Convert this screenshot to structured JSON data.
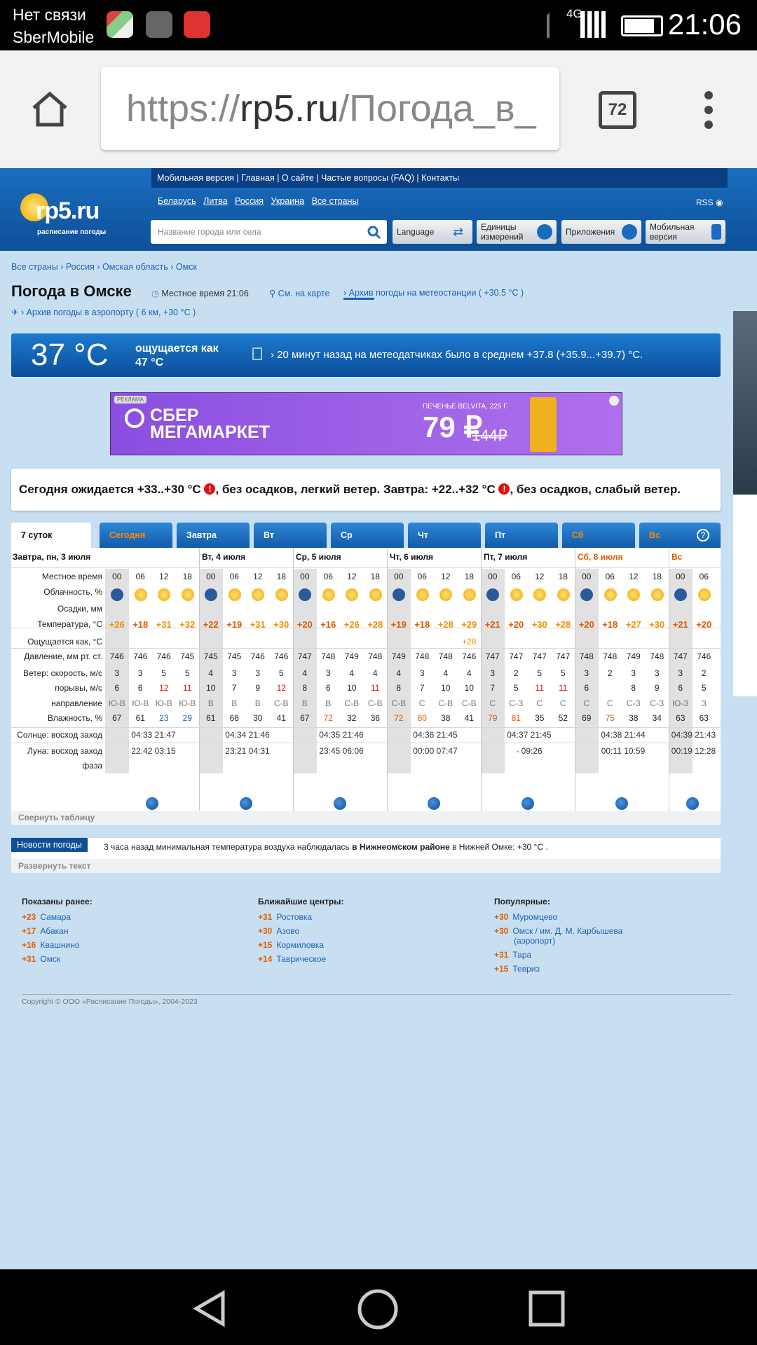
{
  "status_bar": {
    "carrier1": "Нет связи",
    "carrier2": "SberMobile",
    "time": "21:06",
    "network": "4G"
  },
  "browser": {
    "url_prefix": "https://",
    "url_host": "rp5.ru",
    "url_path": "/Погода_в_",
    "tabs_count": "72"
  },
  "site": {
    "topnav": "Мобильная версия  |  Главная  |  О сайте  |  Частые вопросы (FAQ)  |  Контакты",
    "countries": [
      "Беларусь",
      "Литва",
      "Россия",
      "Украина",
      "Все страны"
    ],
    "rss": "RSS",
    "logo_text": "rp5.ru",
    "logo_sub": "расписание погоды",
    "search_placeholder": "Название города или села",
    "btn_language": "Language",
    "btn_units": "Единицы измерений",
    "btn_apps": "Приложения",
    "btn_mobile": "Мобильная версия"
  },
  "breadcrumb": "Все страны › Россия › Омская область › Омск",
  "page_title": "Погода в Омске",
  "local_time": "Местное время  21:06",
  "map_link": "См. на карте",
  "archive_link": "› Архив погоды на метеостанции ( +30.5 °C )",
  "airport_link": "› Архив погоды в аэропорту ( 6 км, +30 °C )",
  "current": {
    "temp": "37 °C",
    "feels": "ощущается как 47 °C",
    "message": "›   20 минут назад на метеодатчиках было в среднем +37.8 (+35.9...+39.7) °C."
  },
  "ad": {
    "tag": "РЕКЛАМА",
    "brand": "СБЕР МЕГАМАРКЕТ",
    "product": "ПЕЧЕНЬЕ BELVITA, 225 Г",
    "price": "79 ₽",
    "old_price": "144₽"
  },
  "forecast_summary": {
    "p1": "Сегодня ожидается +33..+30 °C ",
    "p2": ", без осадков, легкий ветер. Завтра: +22..+32 °C ",
    "p3": ", без осадков, слабый ветер.",
    "warn": "!"
  },
  "day_tabs": [
    "7 суток",
    "Сегодня",
    "Завтра",
    "Вт",
    "Ср",
    "Чт",
    "Пт",
    "Сб",
    "Вс"
  ],
  "table": {
    "days": [
      "Завтра, пн, 3 июля",
      "Вт, 4 июля",
      "Ср, 5 июля",
      "Чт, 6 июля",
      "Пт, 7 июля",
      "Сб, 8 июля",
      "Вс"
    ],
    "row_labels": [
      "Местное время",
      "Облачность, %",
      "Осадки, мм",
      "Температура, °C",
      "Ощущается как, °C",
      "Давление, мм рт. ст.",
      "Ветер: скорость, м/с",
      "порывы, м/с",
      "направление",
      "Влажность, %",
      "Солнце: восход заход",
      "Луна: восход заход",
      "фаза"
    ],
    "hours": [
      "00",
      "06",
      "12",
      "18",
      "00",
      "06",
      "12",
      "18",
      "00",
      "06",
      "12",
      "18",
      "00",
      "06",
      "12",
      "18",
      "00",
      "06",
      "12",
      "18",
      "00",
      "06",
      "12",
      "18",
      "00",
      "06"
    ],
    "temps": [
      "+26",
      "+18",
      "+31",
      "+32",
      "+22",
      "+19",
      "+31",
      "+30",
      "+20",
      "+16",
      "+26",
      "+28",
      "+19",
      "+18",
      "+28",
      "+29",
      "+21",
      "+20",
      "+30",
      "+28",
      "+20",
      "+18",
      "+27",
      "+30",
      "+21",
      "+20"
    ],
    "feels": [
      "",
      "",
      "",
      "",
      "",
      "",
      "",
      "",
      "",
      "",
      "",
      "",
      "",
      "",
      "",
      "+28",
      "",
      "",
      "",
      "",
      "",
      "",
      "",
      "",
      "",
      ""
    ],
    "pressure": [
      "746",
      "746",
      "746",
      "745",
      "745",
      "745",
      "746",
      "746",
      "747",
      "748",
      "749",
      "748",
      "749",
      "748",
      "748",
      "746",
      "747",
      "747",
      "747",
      "747",
      "748",
      "748",
      "749",
      "748",
      "747",
      "746"
    ],
    "wind": [
      "3",
      "3",
      "5",
      "5",
      "4",
      "3",
      "3",
      "5",
      "4",
      "3",
      "4",
      "4",
      "4",
      "3",
      "4",
      "4",
      "3",
      "2",
      "5",
      "5",
      "3",
      "2",
      "3",
      "3",
      "3",
      "2"
    ],
    "gusts": [
      "6",
      "6",
      "12",
      "11",
      "10",
      "7",
      "9",
      "12",
      "8",
      "6",
      "10",
      "11",
      "8",
      "7",
      "10",
      "10",
      "7",
      "5",
      "11",
      "11",
      "6",
      "",
      "8",
      "9",
      "6",
      "5"
    ],
    "direction": [
      "Ю-В",
      "Ю-В",
      "Ю-В",
      "Ю-В",
      "В",
      "В",
      "В",
      "С-В",
      "В",
      "В",
      "С-В",
      "С-В",
      "С-В",
      "С",
      "С-В",
      "С-В",
      "С",
      "С-З",
      "С",
      "С",
      "С",
      "С",
      "С-З",
      "С-З",
      "Ю-З",
      "З"
    ],
    "humidity": [
      "67",
      "61",
      "23",
      "29",
      "61",
      "68",
      "30",
      "41",
      "67",
      "72",
      "32",
      "36",
      "72",
      "80",
      "38",
      "41",
      "79",
      "81",
      "35",
      "52",
      "69",
      "75",
      "38",
      "34",
      "63",
      "63"
    ],
    "sun": [
      "04:33 21:47",
      "04:34 21:46",
      "04:35 21:46",
      "04:36 21:45",
      "04:37 21:45",
      "04:38 21:44",
      "04:39 21:43"
    ],
    "moon": [
      "22:42 03:15",
      "23:21 04:31",
      "23:45 06:06",
      "00:00 07:47",
      "-    09:26",
      "00:11 10:59",
      "00:19 12:28"
    ],
    "collapse": "Свернуть таблицу"
  },
  "news": {
    "header": "Новости погоды",
    "text_a": "3 часа назад минимальная температура воздуха наблюдалась ",
    "text_b": "в Нижнеомском районе",
    "text_c": " в Нижней Омке: +30 °C .",
    "expand": "Развернуть текст"
  },
  "footer": {
    "earlier": {
      "title": "Показаны ранее:",
      "items": [
        [
          "+23",
          "Самара"
        ],
        [
          "+17",
          "Абакан"
        ],
        [
          "+16",
          "Квашнино"
        ],
        [
          "+31",
          "Омск"
        ]
      ]
    },
    "nearby": {
      "title": "Ближайшие центры:",
      "items": [
        [
          "+31",
          "Ростовка"
        ],
        [
          "+30",
          "Азово"
        ],
        [
          "+15",
          "Кормиловка"
        ],
        [
          "+14",
          "Таврическое"
        ]
      ]
    },
    "popular": {
      "title": "Популярные:",
      "items": [
        [
          "+30",
          "Муромцево"
        ],
        [
          "+30",
          "Омск / им. Д. М. Карбышева (аэропорт)"
        ],
        [
          "+31",
          "Тара"
        ],
        [
          "+15",
          "Тевриз"
        ]
      ]
    },
    "copyright": "Copyright © ООО «Расписание Погоды», 2004-2023"
  },
  "colors": {
    "accent": "#0d4f98",
    "temp_hot": "#e05a00",
    "temp_warm": "#f09000",
    "red": "#e01010",
    "link": "#1a62b8"
  }
}
